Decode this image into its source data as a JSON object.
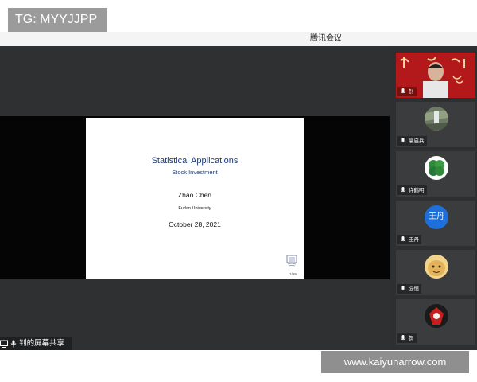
{
  "watermark_top": "TG: MYYJJPP",
  "window": {
    "title": "腾讯会议"
  },
  "slide": {
    "title": "Statistical Applications",
    "subtitle": "Stock Investment",
    "author": "Zhao Chen",
    "institution": "Fudan University",
    "date": "October 28, 2021",
    "page": "1/59"
  },
  "sharer": {
    "label": "钊的屏幕共享"
  },
  "participants": [
    {
      "name": "钊",
      "avatar": "video-feed",
      "mic": "mic-icon"
    },
    {
      "name": "高启兵",
      "avatar": "waterfall-photo",
      "mic": "mic-icon"
    },
    {
      "name": "许鹤明",
      "avatar": "clover-photo",
      "mic": "mic-icon"
    },
    {
      "name": "王丹",
      "avatar_text": "王丹",
      "avatar_color": "#1e6fd9",
      "mic": "mic-icon"
    },
    {
      "name": "@恒",
      "avatar": "cartoon-photo",
      "mic": "mic-icon"
    },
    {
      "name": "贺",
      "avatar": "red-logo-photo",
      "mic": "mic-icon"
    }
  ],
  "watermark_bottom": "www.kaiyunarrow.com"
}
